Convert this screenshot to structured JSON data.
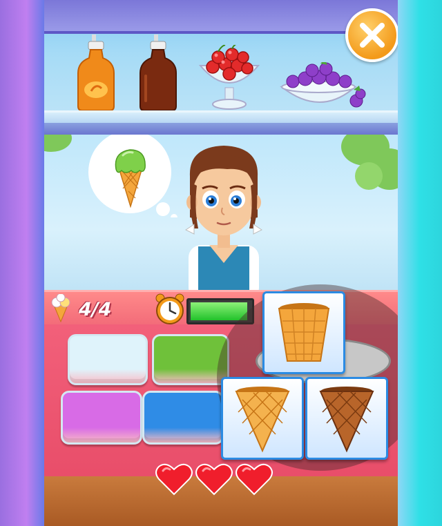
{
  "hud": {
    "served_count": "4/4",
    "timer_fill_fraction": 0.95
  },
  "shelf": {
    "toppings": [
      "orange-sauce-bottle-icon",
      "chocolate-sauce-bottle-icon",
      "cherry-bowl-icon",
      "berry-bowl-icon"
    ]
  },
  "order": {
    "flavor": "green",
    "cone": "waffle-cone"
  },
  "flavors": [
    {
      "name": "white",
      "color": "#dff3fb"
    },
    {
      "name": "green",
      "color": "#6fc13a"
    },
    {
      "name": "pink",
      "color": "#d86be6"
    },
    {
      "name": "blue",
      "color": "#2f8ce6"
    }
  ],
  "cones": [
    "cup-cone",
    "waffle-cone",
    "chocolate-cone"
  ],
  "lives": 3,
  "colors": {
    "accent_orange": "#f39a1a",
    "counter_red": "#f26a78",
    "card_border": "#2b8be3",
    "timer_green": "#36d63a"
  }
}
